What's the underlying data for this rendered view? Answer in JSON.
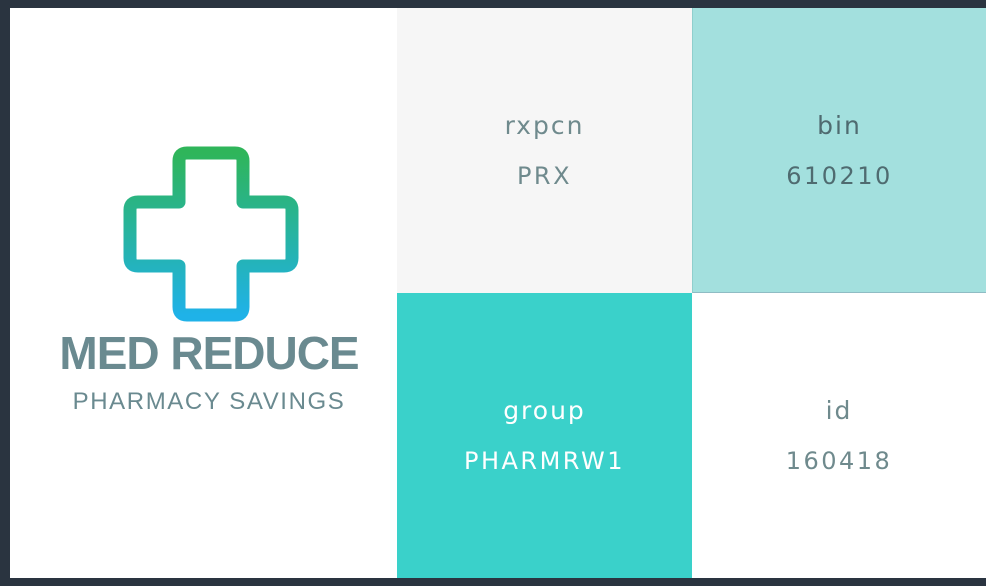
{
  "brand": {
    "title": "MED REDUCE",
    "subtitle": "PHARMACY SAVINGS",
    "logo_icon": "medical-cross-icon",
    "gradient_colors": [
      "#2fb55a",
      "#1fb2e8"
    ]
  },
  "fields": {
    "rxpcn": {
      "label": "rxpcn",
      "value": "PRX"
    },
    "bin": {
      "label": "bin",
      "value": "610210"
    },
    "group": {
      "label": "group",
      "value": "PHARMRW1"
    },
    "id": {
      "label": "id",
      "value": "160418"
    }
  },
  "colors": {
    "rxpcn_bg": "#f6f6f6",
    "bin_bg": "#a3e0de",
    "group_bg": "#3ad1ca",
    "id_bg": "#ffffff",
    "text_gray": "#6f8a8d"
  }
}
